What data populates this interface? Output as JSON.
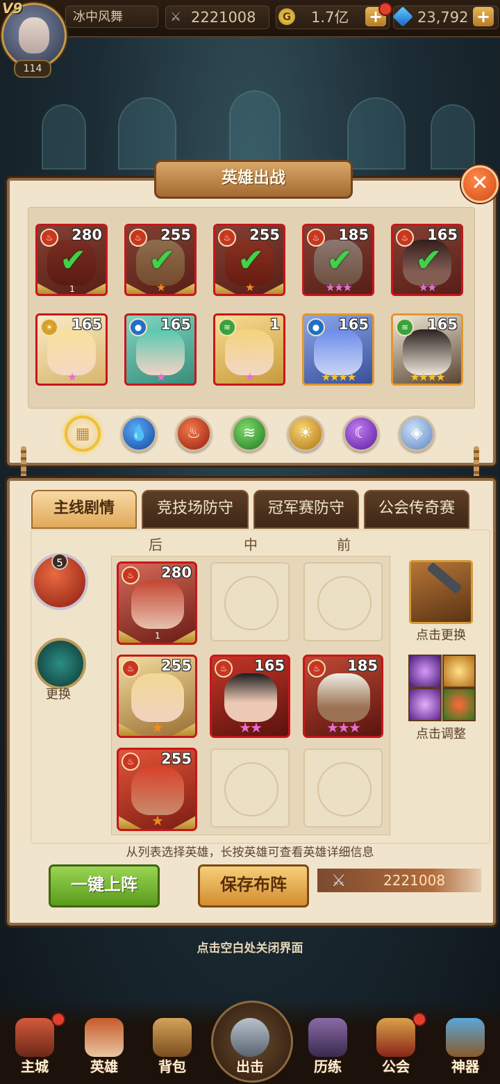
{
  "topbar": {
    "vip": "V9",
    "level": "114",
    "player_name": "冰中风舞",
    "power": "2221008",
    "gold": "1.7亿",
    "gold_icon": "G",
    "gems": "23,792",
    "plus": "+"
  },
  "hero_select": {
    "title": "英雄出战",
    "close": "✕",
    "row1": [
      {
        "level": "280",
        "stars": "1",
        "element": "fire",
        "deployed": true
      },
      {
        "level": "255",
        "stars": "★",
        "element": "fire",
        "deployed": true
      },
      {
        "level": "255",
        "stars": "★",
        "element": "fire",
        "deployed": true
      },
      {
        "level": "185",
        "stars": "★★★",
        "element": "fire",
        "deployed": true
      },
      {
        "level": "165",
        "stars": "★★",
        "element": "fire",
        "deployed": true
      }
    ],
    "row2": [
      {
        "level": "165",
        "stars": "★",
        "element": "light"
      },
      {
        "level": "165",
        "stars": "★",
        "element": "water"
      },
      {
        "level": "1",
        "stars": "★",
        "element": "wind"
      },
      {
        "level": "165",
        "stars": "★★★★",
        "element": "water"
      },
      {
        "level": "165",
        "stars": "★★★★",
        "element": "wind"
      }
    ],
    "filters": [
      "all",
      "water",
      "fire",
      "wind",
      "light",
      "dark",
      "void"
    ],
    "checkmark": "✔"
  },
  "formation": {
    "tabs": [
      "主线剧情",
      "竞技场防守",
      "冠军赛防守",
      "公会传奇赛"
    ],
    "columns": [
      "后",
      "中",
      "前"
    ],
    "grid": {
      "r1c1": {
        "level": "280",
        "stars": "1"
      },
      "r2c1": {
        "level": "255",
        "stars": "★"
      },
      "r2c2": {
        "level": "165",
        "stars": "★★"
      },
      "r2c3": {
        "level": "185",
        "stars": "★★★"
      },
      "r3c1": {
        "level": "255",
        "stars": "★"
      }
    },
    "element_badge": "5",
    "swap_label": "更换",
    "weapon_label": "点击更换",
    "skills_label": "点击调整",
    "hint": "从列表选择英雄，长按英雄可查看英雄详细信息",
    "btn_auto": "一键上阵",
    "btn_save": "保存布阵",
    "power": "2221008",
    "close_hint": "点击空白处关闭界面"
  },
  "nav": [
    "主城",
    "英雄",
    "背包",
    "出击",
    "历练",
    "公会",
    "神器"
  ],
  "colors": {
    "fire": "#c9361e",
    "water": "#1f6fc9",
    "wind": "#3aa23a",
    "light": "#d6a024",
    "dark": "#7a34b8",
    "void": "#7fa3d6"
  }
}
